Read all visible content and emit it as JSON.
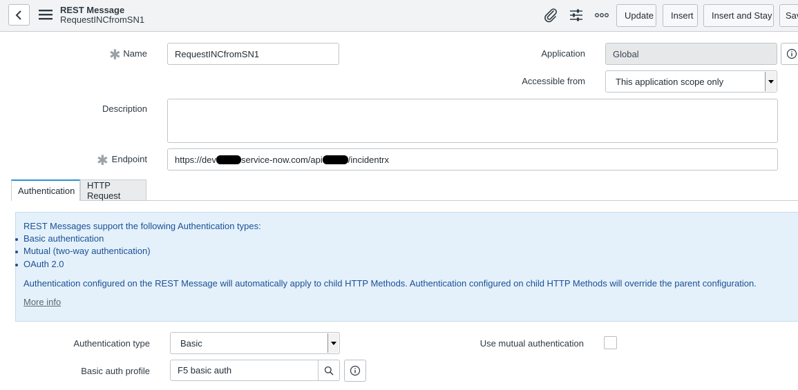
{
  "header": {
    "record_type": "REST Message",
    "record_name": "RequestINCfromSN1",
    "buttons": {
      "update": "Update",
      "insert": "Insert",
      "insert_and_stay": "Insert and Stay",
      "save": "Save"
    },
    "icons": [
      "back-icon",
      "menu-icon",
      "paperclip-icon",
      "sliders-icon",
      "more-icon"
    ]
  },
  "form": {
    "name": {
      "label": "Name",
      "value": "RequestINCfromSN1",
      "required": true
    },
    "application": {
      "label": "Application",
      "value": "Global"
    },
    "accessible_from": {
      "label": "Accessible from",
      "value": "This application scope only"
    },
    "description": {
      "label": "Description",
      "value": ""
    },
    "endpoint": {
      "label": "Endpoint",
      "value_part1": "https://dev",
      "value_part2": "service-now.com/api",
      "value_part3": "/incidentrx",
      "required": true
    }
  },
  "tabs": [
    {
      "label": "Authentication",
      "active": true
    },
    {
      "label": "HTTP Request",
      "active": false
    }
  ],
  "info": {
    "intro": "REST Messages support the following Authentication types:",
    "items": [
      "Basic authentication",
      "Mutual (two-way authentication)",
      "OAuth 2.0"
    ],
    "note": "Authentication configured on the REST Message will automatically apply to child HTTP Methods. Authentication configured on child HTTP Methods will override the parent configuration.",
    "more_info": "More info"
  },
  "auth": {
    "type": {
      "label": "Authentication type",
      "value": "Basic"
    },
    "mutual": {
      "label": "Use mutual authentication",
      "checked": false
    },
    "profile": {
      "label": "Basic auth profile",
      "value": "F5 basic auth"
    }
  },
  "colors": {
    "accent": "#2b8fd8",
    "info_bg": "#e4f1fb",
    "info_text": "#1c4f94"
  }
}
